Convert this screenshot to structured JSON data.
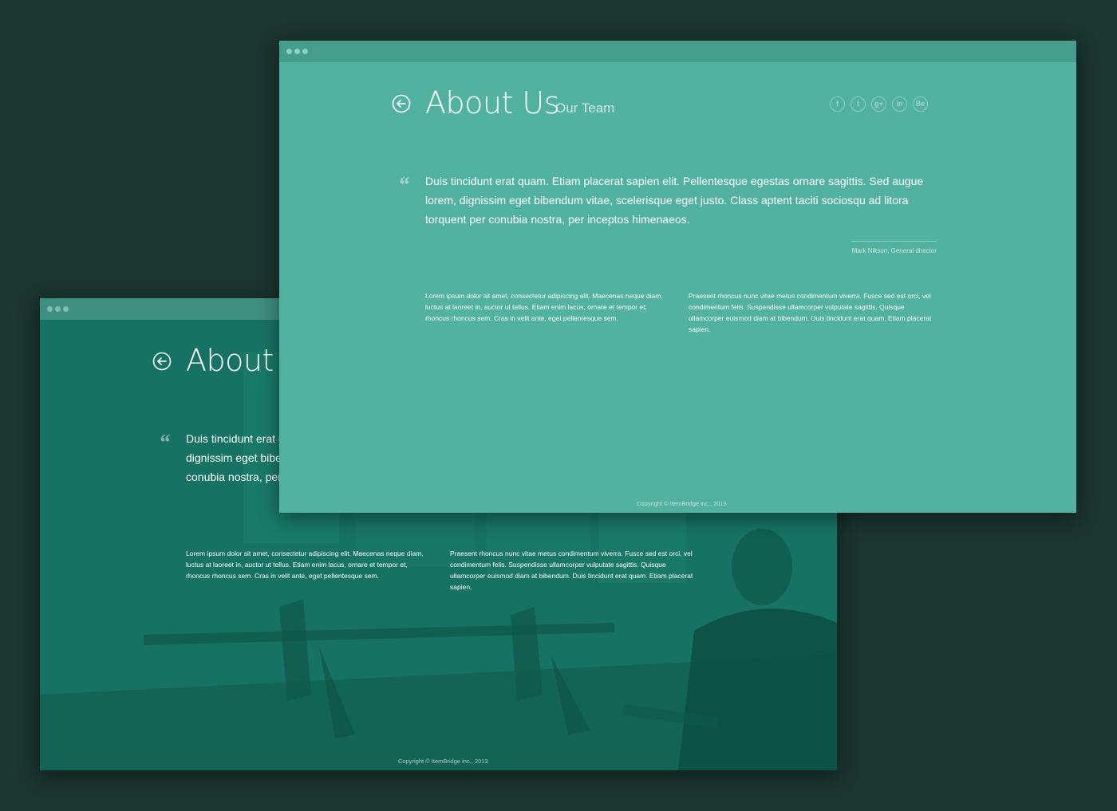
{
  "colors": {
    "page_background": "#1b3530",
    "front_window": "#51b29f",
    "back_window": "#167363",
    "text": "#ffffff"
  },
  "back_window": {
    "heading": "About U",
    "quote_mark": "“",
    "quote_lines": [
      "Duis tincidunt erat c",
      "dignissim eget bibe",
      "conubia nostra, per"
    ],
    "column_left": "Lorem ipsum dolor sit amet, consectetur adipiscing elit. Maecenas neque diam, luctus at laoreet in, auctor ut tellus. Etiam enim lacus, ornare et tempor et, rhoncus rhoncus sem. Cras in velit ante, eget pellentesque sem.",
    "column_right": "Praesent rhoncus nunc vitae metus condimentum viverra. Fusce sed est orci, vel condimentum felis. Suspendisse ullamcorper vulputate sagittis. Quisque ullamcorper euismod diam at bibendum. Duis tincidunt erat quam. Etiam placerat sapien.",
    "copyright": "Copyright © ItemBridge inc., 2013"
  },
  "front_window": {
    "heading": "About Us",
    "subheading": "Our Team",
    "social_icons": [
      {
        "name": "facebook-icon",
        "glyph": "f"
      },
      {
        "name": "twitter-icon",
        "glyph": "t"
      },
      {
        "name": "google-plus-icon",
        "glyph": "g+"
      },
      {
        "name": "linkedin-icon",
        "glyph": "in"
      },
      {
        "name": "behance-icon",
        "glyph": "Be"
      }
    ],
    "quote_mark": "“",
    "quote": "Duis tincidunt erat quam. Etiam placerat sapien elit. Pellentesque egestas ornare sagittis. Sed augue lorem, dignissim eget bibendum vitae, scelerisque eget justo. Class aptent taciti sociosqu ad litora torquent per conubia nostra, per inceptos himenaeos.",
    "author": "Mark Nikson, General director",
    "column_left": "Lorem ipsum dolor sit amet, consectetur adipiscing elit. Maecenas neque diam, luctus at laoreet in, auctor ut tellus. Etiam enim lacus, ornare et tempor et, rhoncus rhoncus sem. Cras in velit ante, eget pellentesque sem.",
    "column_right": "Praesent rhoncus nunc vitae metus condimentum viverra. Fusce sed est orci, vel condimentum felis. Suspendisse ullamcorper vulputate sagittis. Quisque ullamcorper euismod diam at bibendum. Duis tincidunt erat quam. Etiam placerat sapien.",
    "copyright": "Copyright © ItemBridge inc., 2013"
  }
}
